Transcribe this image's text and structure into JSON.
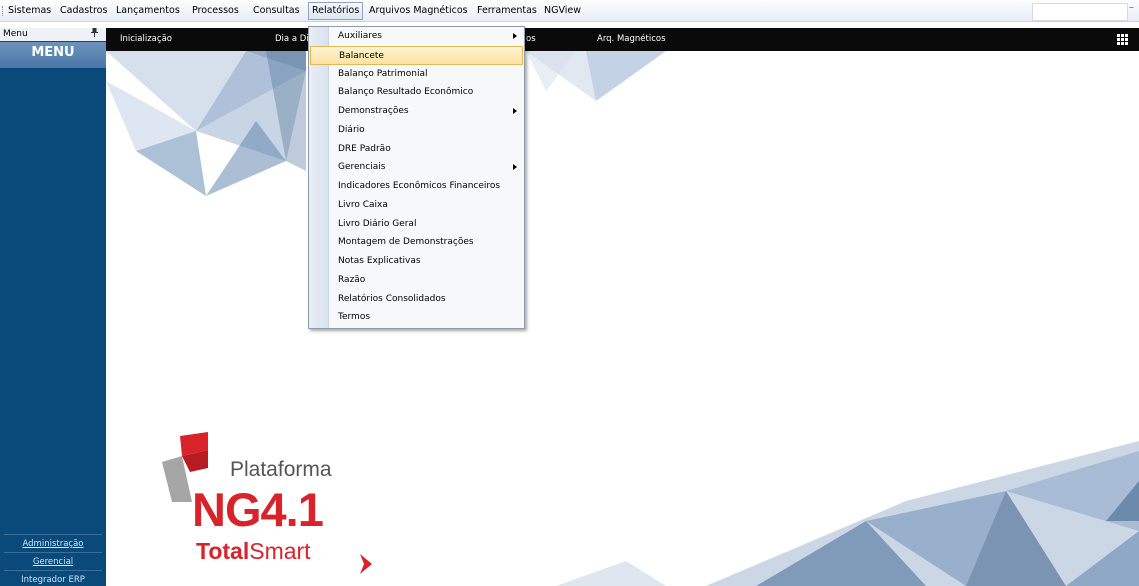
{
  "menubar": {
    "items": [
      "Sistemas",
      "Cadastros",
      "Lançamentos",
      "Processos",
      "Consultas",
      "Relatórios",
      "Arquivos Magnéticos",
      "Ferramentas",
      "NGView"
    ],
    "minimize": "–"
  },
  "left_panel": {
    "header": "Menu",
    "title": "MENU",
    "links": [
      "Administração",
      "Gerencial",
      "Integrador ERP"
    ]
  },
  "toolbar": {
    "tabs": [
      "Inicialização",
      "Dia a Dia",
      "os",
      "Arq. Magnéticos"
    ]
  },
  "dropdown": {
    "items": [
      {
        "label": "Auxiliares",
        "submenu": true
      },
      {
        "label": "Balancete",
        "submenu": false,
        "highlighted": true
      },
      {
        "label": "Balanço Patrimonial",
        "submenu": false
      },
      {
        "label": "Balanço Resultado Econômico",
        "submenu": false
      },
      {
        "label": "Demonstrações",
        "submenu": true
      },
      {
        "label": "Diário",
        "submenu": false
      },
      {
        "label": "DRE Padrão",
        "submenu": false
      },
      {
        "label": "Gerenciais",
        "submenu": true
      },
      {
        "label": "Indicadores Econômicos Financeiros",
        "submenu": false
      },
      {
        "label": "Livro Caixa",
        "submenu": false
      },
      {
        "label": "Livro Diário Geral",
        "submenu": false
      },
      {
        "label": "Montagem de Demonstrações",
        "submenu": false
      },
      {
        "label": "Notas Explicativas",
        "submenu": false
      },
      {
        "label": "Razão",
        "submenu": false
      },
      {
        "label": "Relatórios Consolidados",
        "submenu": false
      },
      {
        "label": "Termos",
        "submenu": false
      }
    ]
  },
  "logo": {
    "line1": "Plataforma",
    "line2": "NG4.1",
    "line3_bold": "Total",
    "line3_rest": "Smart"
  },
  "colors": {
    "panel": "#0a4a7a",
    "toolbar": "#0a0a0a",
    "brand_red": "#d8232a",
    "highlight": "#fbe3a0"
  }
}
